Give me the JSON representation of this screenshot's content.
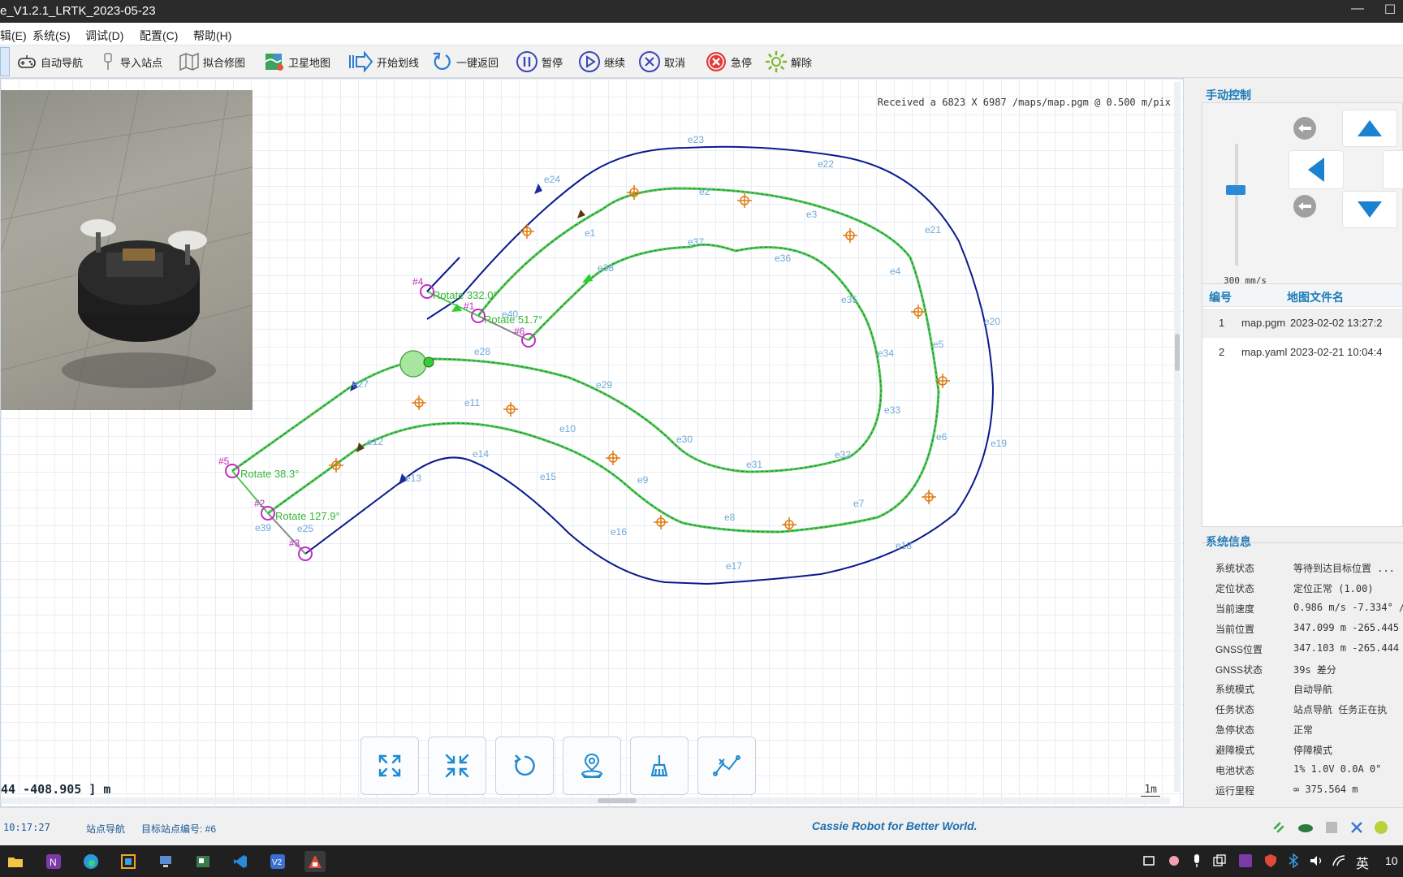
{
  "window": {
    "title": "e_V1.2.1_LRTK_2023-05-23"
  },
  "menu": [
    "辑(E)",
    "系统(S)",
    "调试(D)",
    "配置(C)",
    "帮助(H)"
  ],
  "toolbar": {
    "auto_nav": "自动导航",
    "import_station": "导入站点",
    "fit_map": "拟合修图",
    "satellite_map": "卫星地图",
    "start_line": "开始划线",
    "one_key_return": "一键返回",
    "pause": "暂停",
    "resume": "继续",
    "cancel": "取消",
    "estop": "急停",
    "release": "解除"
  },
  "map": {
    "received": "Received a 6823 X 6987 /maps/map.pgm @ 0.500 m/pix",
    "coords": "44 -408.905 ] m",
    "scale": "1m",
    "edges": [
      "e23",
      "e22",
      "e21",
      "e20",
      "e19",
      "e18",
      "e17",
      "e16",
      "e15",
      "e14",
      "e13",
      "e24",
      "e2",
      "e3",
      "e4",
      "e5",
      "e6",
      "e7",
      "e8",
      "e9",
      "e10",
      "e11",
      "e12",
      "e25",
      "e37",
      "e36",
      "e35",
      "e34",
      "e33",
      "e32",
      "e31",
      "e30",
      "e29",
      "e28",
      "e27",
      "e38",
      "e39",
      "e40",
      "e1"
    ],
    "stations": [
      "#1",
      "#2",
      "#3",
      "#4",
      "#5",
      "#6"
    ],
    "rotations": [
      "Rotate 332.0°",
      "Rotate 51.7°",
      "Rotate 38.3°",
      "Rotate 127.9°"
    ]
  },
  "manual_control": {
    "title": "手动控制",
    "speed": "300 mm/s",
    "speed_level": 0.38
  },
  "map_files": {
    "header_id": "编号",
    "header_name": "地图文件名",
    "rows": [
      {
        "id": "1",
        "name": "map.pgm",
        "date": "2023-02-02 13:27:2"
      },
      {
        "id": "2",
        "name": "map.yaml",
        "date": "2023-02-21 10:04:4"
      }
    ]
  },
  "system_info": {
    "title": "系统信息",
    "rows": [
      {
        "k": "系统状态",
        "v": "等待到达目标位置 ..."
      },
      {
        "k": "定位状态",
        "v": "定位正常 (1.00)"
      },
      {
        "k": "当前速度",
        "v": "0.986 m/s  -7.334° /s"
      },
      {
        "k": "当前位置",
        "v": "347.099 m  -265.445 m"
      },
      {
        "k": "GNSS位置",
        "v": "347.103 m  -265.444 m"
      },
      {
        "k": "GNSS状态",
        "v": "39s  差分"
      },
      {
        "k": "系统模式",
        "v": "自动导航"
      },
      {
        "k": "任务状态",
        "v": "站点导航    任务正在执"
      },
      {
        "k": "急停状态",
        "v": "正常"
      },
      {
        "k": "避障模式",
        "v": "停障模式"
      },
      {
        "k": "电池状态",
        "v": "1%   1.0V   0.0A   0°"
      },
      {
        "k": "运行里程",
        "v": "∞ 375.564 m"
      }
    ]
  },
  "status": {
    "time": "10:17:27",
    "mode": "站点导航",
    "target": "目标站点编号: #6",
    "slogan": "Cassie Robot for Better World."
  },
  "taskbar": {
    "ime": "英",
    "clock": "10"
  },
  "colors": {
    "accent": "#1d7ab8",
    "path_blue": "#0a1a8c",
    "path_green": "#4fc84f",
    "station": "#c02ec0"
  }
}
